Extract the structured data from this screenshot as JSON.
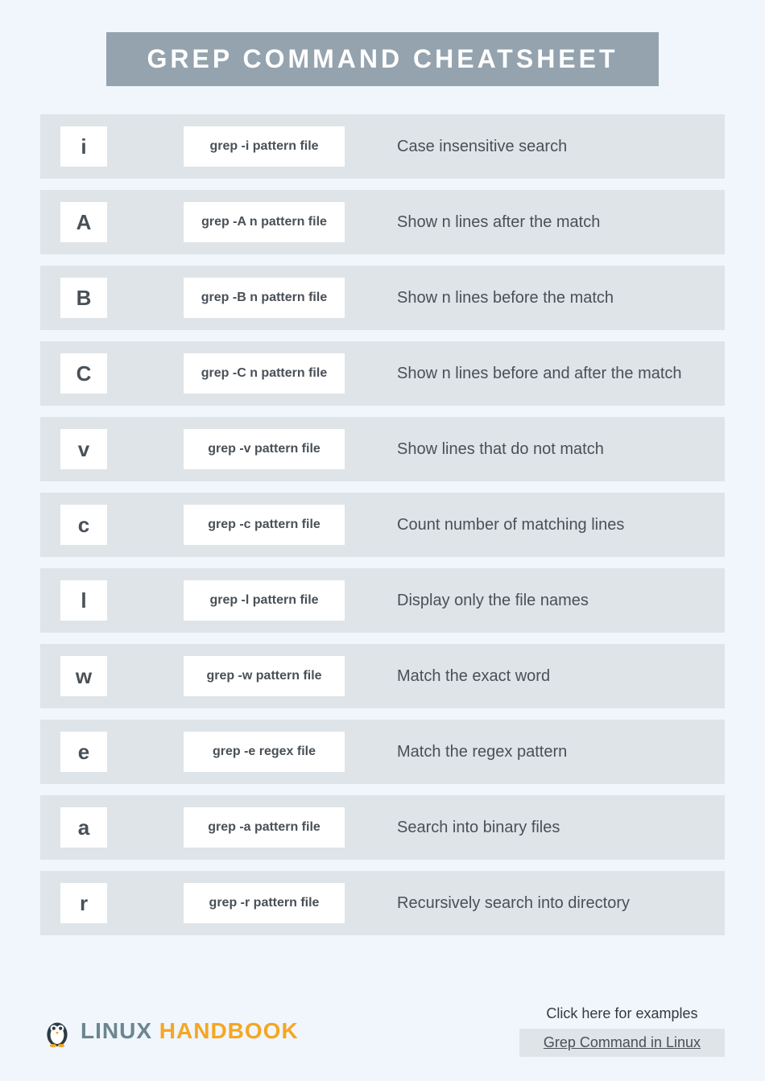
{
  "title": "GREP COMMAND CHEATSHEET",
  "rows": [
    {
      "flag": "i",
      "cmd": "grep -i pattern file",
      "desc": "Case insensitive search"
    },
    {
      "flag": "A",
      "cmd": "grep -A n pattern file",
      "desc": "Show n lines after the match"
    },
    {
      "flag": "B",
      "cmd": "grep -B n pattern file",
      "desc": "Show n lines before the match"
    },
    {
      "flag": "C",
      "cmd": "grep -C n pattern file",
      "desc": "Show n lines before and after the match"
    },
    {
      "flag": "v",
      "cmd": "grep -v pattern file",
      "desc": "Show lines that do not match"
    },
    {
      "flag": "c",
      "cmd": "grep -c pattern file",
      "desc": "Count number of matching lines"
    },
    {
      "flag": "l",
      "cmd": "grep -l pattern file",
      "desc": "Display only the file names"
    },
    {
      "flag": "w",
      "cmd": "grep -w pattern file",
      "desc": "Match the exact word"
    },
    {
      "flag": "e",
      "cmd": "grep -e regex file",
      "desc": "Match the regex pattern"
    },
    {
      "flag": "a",
      "cmd": "grep -a pattern file",
      "desc": "Search into binary files"
    },
    {
      "flag": "r",
      "cmd": "grep -r pattern file",
      "desc": "Recursively search into directory"
    }
  ],
  "brand_linux": "LINUX ",
  "brand_handbook": "HANDBOOK",
  "examples_label": "Click here for examples",
  "link_label": "Grep Command in Linux"
}
